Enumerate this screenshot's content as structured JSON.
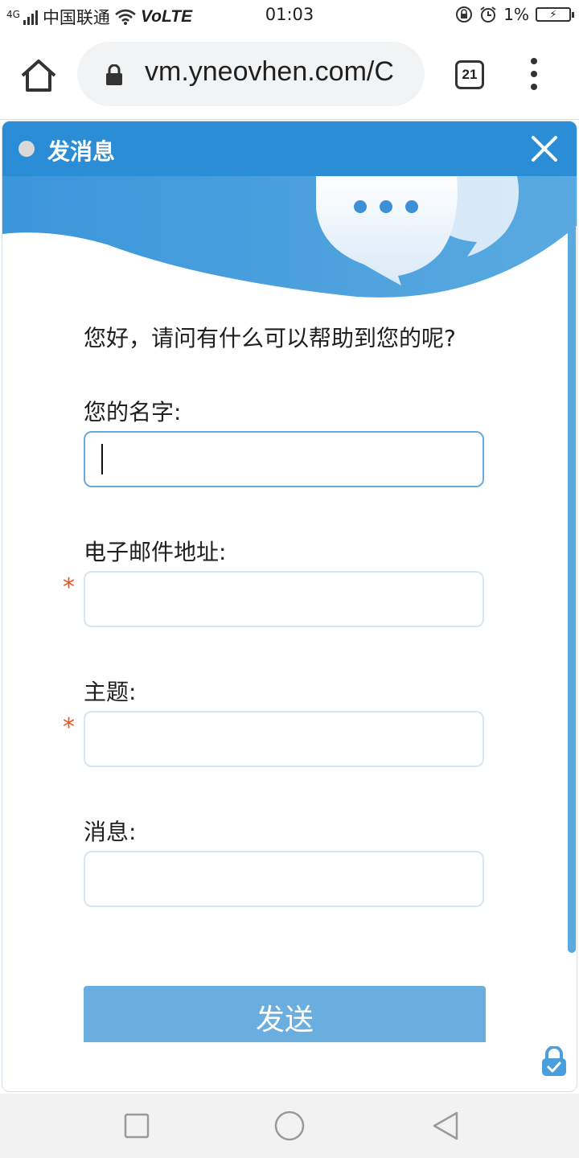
{
  "status_bar": {
    "network": "4G",
    "carrier": "中国联通",
    "volte": "VoLTE",
    "time": "01:03",
    "battery": "1%"
  },
  "browser": {
    "url": "vm.yneovhen.com/C",
    "tab_count": "21"
  },
  "widget": {
    "title": "发消息",
    "greeting": "您好，请问有什么可以帮助到您的呢?",
    "fields": [
      {
        "label": "您的名字:",
        "value": "",
        "required": false
      },
      {
        "label": "电子邮件地址:",
        "value": "",
        "required": true
      },
      {
        "label": "主题:",
        "value": "",
        "required": true
      },
      {
        "label": "消息:",
        "value": "",
        "required": false
      }
    ],
    "required_marker": "*",
    "send_label": "发送"
  },
  "colors": {
    "header": "#2a8dd6",
    "banner": "#4a9edc",
    "send_button": "#6aaee0",
    "required": "#e8541e"
  }
}
